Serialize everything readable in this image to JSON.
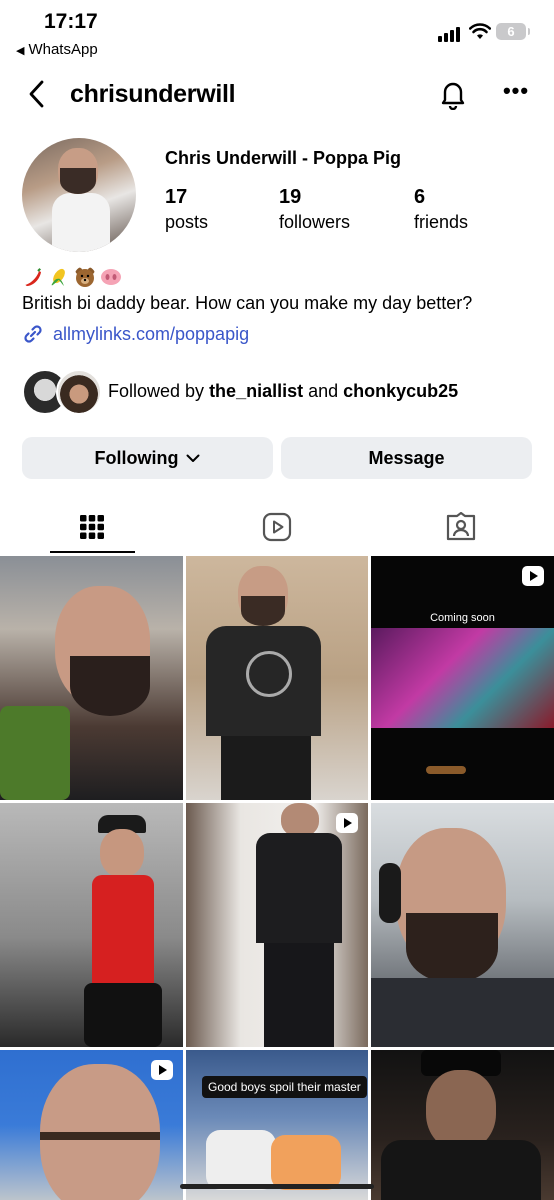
{
  "status_bar": {
    "time": "17:17",
    "back_app": "WhatsApp",
    "battery": "6"
  },
  "header": {
    "username": "chrisunderwill"
  },
  "profile": {
    "display_name": "Chris Underwill - Poppa Pig",
    "stats": [
      {
        "value": "17",
        "label": "posts"
      },
      {
        "value": "19",
        "label": "followers"
      },
      {
        "value": "6",
        "label": "friends"
      }
    ],
    "emojis": [
      "chili-pepper-emoji",
      "corn-emoji",
      "bear-emoji",
      "pig-nose-emoji"
    ],
    "bio": "British bi daddy bear. How can you make my day better?",
    "link": "allmylinks.com/poppapig",
    "followed_by": {
      "prefix": "Followed by ",
      "user1": "the_niallist",
      "joiner": " and ",
      "user2": "chonkycub25"
    }
  },
  "actions": {
    "following_label": "Following",
    "message_label": "Message"
  },
  "tabs": [
    "grid-icon",
    "reels-icon",
    "tagged-icon"
  ],
  "grid": {
    "captions": {
      "coming_soon": "Coming soon",
      "good_boys": "Good boys spoil their master"
    }
  },
  "colors": {
    "link": "#3a56c9",
    "button_bg": "#eceef1",
    "battery": "#c9c9cb"
  }
}
